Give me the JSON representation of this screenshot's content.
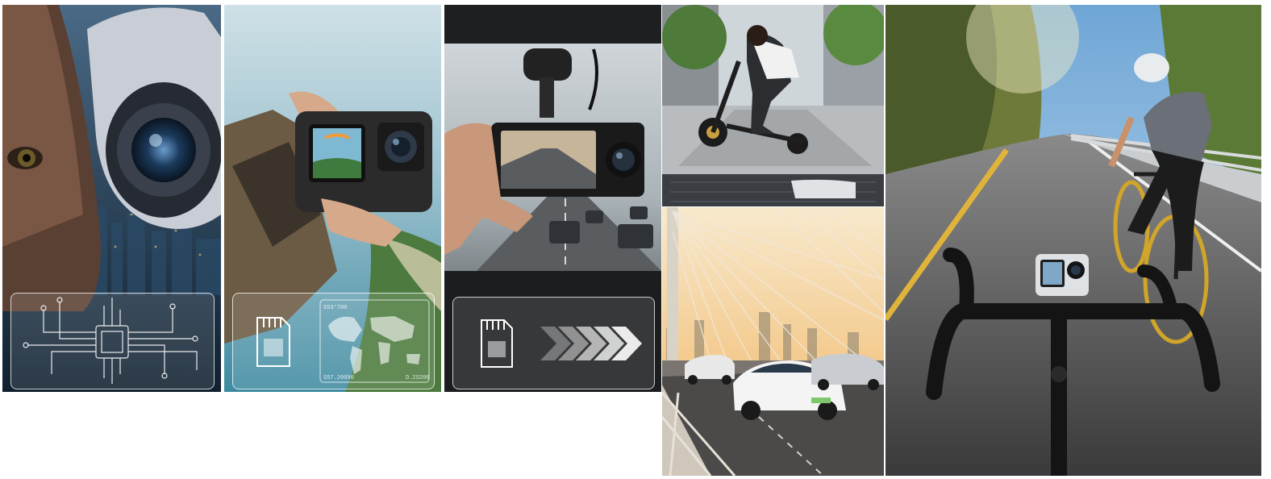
{
  "panels": [
    {
      "name": "security-camera-panel",
      "icon": "microchip-icon"
    },
    {
      "name": "action-camera-panel",
      "icon": "sd-card-icon",
      "map_labels": {
        "top_left": "S53°700",
        "bottom_left": "S57.20090",
        "bottom_right": "D.2S200"
      }
    },
    {
      "name": "dash-camera-panel",
      "icon": "sd-card-icon",
      "secondary_icon": "chevrons-right-icon"
    },
    {
      "name": "scooter-rider-panel"
    },
    {
      "name": "bridge-traffic-panel"
    },
    {
      "name": "cyclist-panel",
      "icon": "handlebar-camera"
    }
  ],
  "colors": {
    "sky": "#9fc6dd",
    "night_blue": "#1c3a55",
    "road": "#3a3a3a",
    "sunset": "#f3c98b",
    "camera_body": "#2b2b2b"
  }
}
